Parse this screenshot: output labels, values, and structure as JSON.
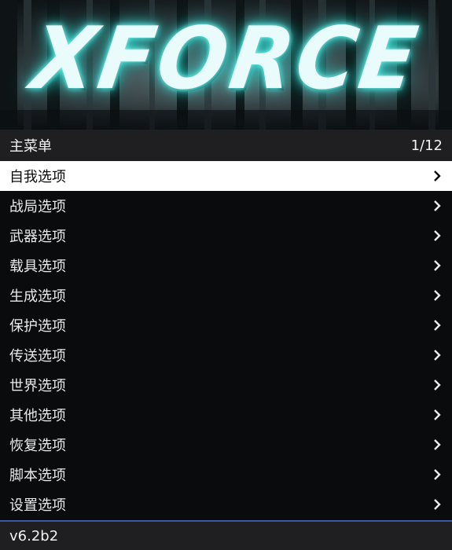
{
  "banner": {
    "logo_text": "XFORCE",
    "glow_color": "#3fd8d0"
  },
  "header": {
    "title": "主菜单",
    "counter": "1/12"
  },
  "items": [
    {
      "label": "自我选项",
      "icon": "chevron-right-icon"
    },
    {
      "label": "战局选项",
      "icon": "chevron-right-icon"
    },
    {
      "label": "武器选项",
      "icon": "chevron-right-icon"
    },
    {
      "label": "载具选项",
      "icon": "chevron-right-icon"
    },
    {
      "label": "生成选项",
      "icon": "chevron-right-icon"
    },
    {
      "label": "保护选项",
      "icon": "chevron-right-icon"
    },
    {
      "label": "传送选项",
      "icon": "chevron-right-icon"
    },
    {
      "label": "世界选项",
      "icon": "chevron-right-icon"
    },
    {
      "label": "其他选项",
      "icon": "chevron-right-icon"
    },
    {
      "label": "恢复选项",
      "icon": "chevron-right-icon"
    },
    {
      "label": "脚本选项",
      "icon": "chevron-right-icon"
    },
    {
      "label": "设置选项",
      "icon": "chevron-right-icon"
    }
  ],
  "selected_index": 0,
  "footer": {
    "version": "v6.2b2",
    "accent_color": "#3a57a8"
  }
}
